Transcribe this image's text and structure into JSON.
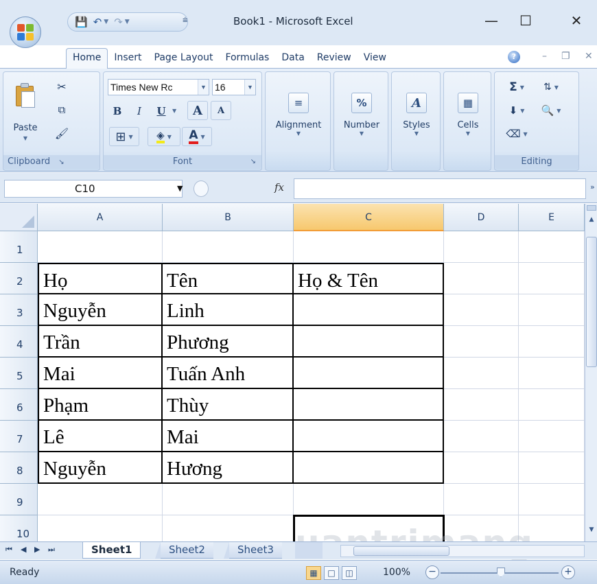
{
  "window": {
    "title": "Book1 - Microsoft Excel",
    "minimize": "—",
    "maximize": "☐",
    "close": "✕"
  },
  "quick_access": {
    "customize_glyph": "⩧"
  },
  "tabs": [
    "Home",
    "Insert",
    "Page Layout",
    "Formulas",
    "Data",
    "Review",
    "View"
  ],
  "active_tab": "Home",
  "ribbon": {
    "clipboard": {
      "label": "Clipboard",
      "paste": "Paste"
    },
    "font": {
      "label": "Font",
      "font_name": "Times New Rc",
      "font_size": "16",
      "bold": "B",
      "italic": "I",
      "underline": "U",
      "grow": "A",
      "shrink": "A",
      "font_color_glyph": "A"
    },
    "alignment": {
      "label": "Alignment"
    },
    "number": {
      "label": "Number",
      "glyph": "%"
    },
    "styles": {
      "label": "Styles"
    },
    "cells": {
      "label": "Cells"
    },
    "editing": {
      "label": "Editing",
      "sum_glyph": "Σ"
    }
  },
  "formula_bar": {
    "name_box": "C10",
    "fx": "fx",
    "formula": ""
  },
  "sheet": {
    "columns": [
      "A",
      "B",
      "C",
      "D",
      "E"
    ],
    "selected_column": "C",
    "rows": [
      {
        "num": "1",
        "cells": [
          "",
          "",
          "",
          "",
          ""
        ]
      },
      {
        "num": "2",
        "cells": [
          "Họ",
          "Tên",
          "Họ & Tên",
          "",
          ""
        ]
      },
      {
        "num": "3",
        "cells": [
          "Nguyễn",
          "Linh",
          "",
          "",
          ""
        ]
      },
      {
        "num": "4",
        "cells": [
          "Trần",
          "Phương",
          "",
          "",
          ""
        ]
      },
      {
        "num": "5",
        "cells": [
          "Mai",
          "Tuấn Anh",
          "",
          "",
          ""
        ]
      },
      {
        "num": "6",
        "cells": [
          "Phạm",
          "Thùy",
          "",
          "",
          ""
        ]
      },
      {
        "num": "7",
        "cells": [
          "Lê",
          "Mai",
          "",
          "",
          ""
        ]
      },
      {
        "num": "8",
        "cells": [
          "Nguyễn",
          "Hương",
          "",
          "",
          ""
        ]
      },
      {
        "num": "9",
        "cells": [
          "",
          "",
          "",
          "",
          ""
        ]
      },
      {
        "num": "10",
        "cells": [
          "",
          "",
          "",
          "",
          ""
        ]
      }
    ],
    "selected_cell": "C10"
  },
  "sheet_tabs": [
    "Sheet1",
    "Sheet2",
    "Sheet3"
  ],
  "active_sheet": "Sheet1",
  "status": {
    "text": "Ready",
    "zoom": "100%"
  },
  "watermark": "uantrimang",
  "colors": {
    "ribbon_bg": "#dce8f6",
    "selected_header": "#f7c86e",
    "gridline": "#d0d7e5"
  }
}
